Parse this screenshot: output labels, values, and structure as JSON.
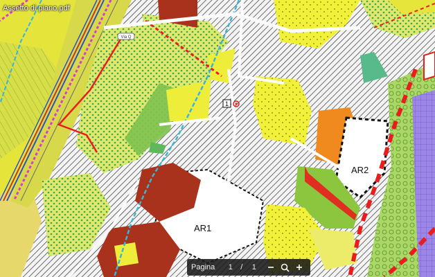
{
  "document": {
    "title": "Assetto di piano.pdf"
  },
  "map": {
    "zone_labels": [
      "AR1",
      "AR2"
    ],
    "marker_number": "1",
    "road_sign": "Via Q"
  },
  "pager": {
    "page_label": "Pagina",
    "current_page": "1",
    "separator": "/",
    "total_pages": "1"
  },
  "icons": {
    "zoom_out": "minus-icon",
    "zoom": "magnifier-icon",
    "zoom_in": "plus-icon"
  },
  "colors": {
    "yellow": "#ecec38",
    "olive": "#c9d23a",
    "green_dotted": "#8cc63f",
    "brown": "#a8321c",
    "orange": "#f08a1e",
    "purple": "#9b7fe0",
    "red_boundary": "#e81e1e",
    "cyan": "#39b5d8",
    "magenta": "#d83dcf"
  }
}
